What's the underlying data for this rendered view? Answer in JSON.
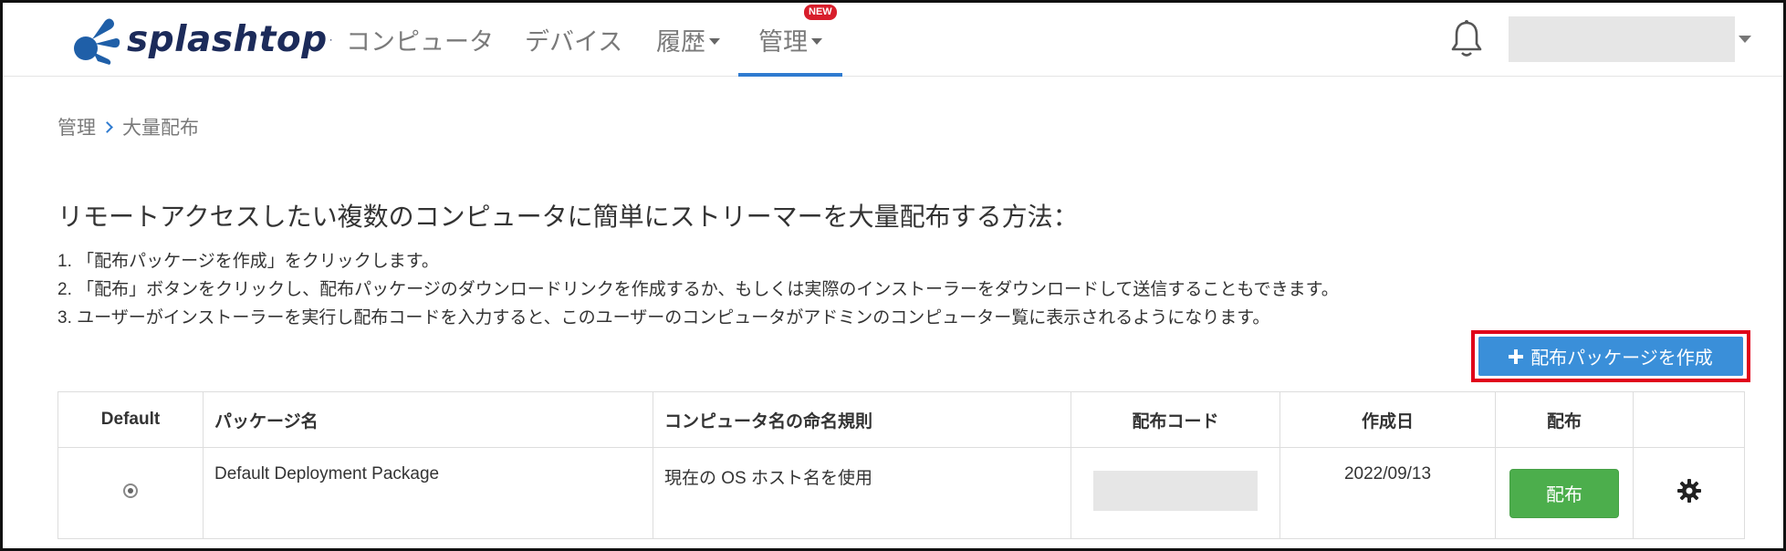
{
  "brand": {
    "name": "splashtop",
    "trademark": "·"
  },
  "nav": {
    "computers": "コンピュータ",
    "devices": "デバイス",
    "history": "履歴",
    "manage": "管理",
    "new_badge": "NEW"
  },
  "breadcrumb": {
    "parent": "管理",
    "current": "大量配布"
  },
  "heading": "リモートアクセスしたい複数のコンピュータに簡単にストリーマーを大量配布する方法：",
  "steps": [
    "1. 「配布パッケージを作成」をクリックします。",
    "2. 「配布」ボタンをクリックし、配布パッケージのダウンロードリンクを作成するか、もしくは実際のインストーラーをダウンロードして送信することもできます。",
    "3. ユーザーがインストーラーを実行し配布コードを入力すると、このユーザーのコンピュータがアドミンのコンピューター覧に表示されるようになります。"
  ],
  "create_button": "配布パッケージを作成",
  "table": {
    "headers": [
      "Default",
      "パッケージ名",
      "コンピュータ名の命名規則",
      "配布コード",
      "作成日",
      "配布",
      ""
    ],
    "rows": [
      {
        "default": true,
        "name": "Default Deployment Package",
        "naming_rule": "現在の OS ホスト名を使用",
        "code": "",
        "created": "2022/09/13",
        "deploy_label": "配布"
      }
    ]
  },
  "colors": {
    "accent": "#2f7bd0",
    "create_button": "#3a8fd9",
    "deploy_button": "#4cae4c",
    "highlight": "#e0001a",
    "badge": "#d81e2b"
  },
  "icons": [
    "splashtop-logo-icon",
    "bell-icon",
    "chevron-down-icon",
    "chevron-right-icon",
    "plus-icon",
    "gear-icon"
  ]
}
